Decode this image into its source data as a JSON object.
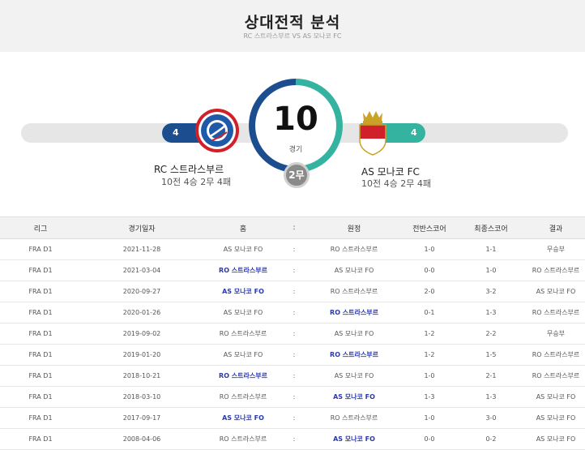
{
  "header": {
    "title": "상대전적 분석",
    "subtitle": "RC 스트라스부르 VS AS 모나코 FC"
  },
  "summary": {
    "total_games": "10",
    "games_unit": "경기",
    "draws_label": "2무",
    "left_wins": "4",
    "right_wins": "4"
  },
  "teams": {
    "home": {
      "name": "RC 스트라스부르",
      "record": "10전 4승 2무 4패",
      "color": "#1b4d8f"
    },
    "away": {
      "name": "AS 모나코 FC",
      "record": "10전 4승 2무 4패",
      "color": "#34b3a0"
    }
  },
  "colors": {
    "draw": "#8a8a8a",
    "winner_text": "#2b3aa8"
  },
  "table": {
    "headers": [
      "리그",
      "경기일자",
      "홈",
      ":",
      "원정",
      "전반스코어",
      "최종스코어",
      "결과"
    ],
    "rows": [
      {
        "league": "FRA D1",
        "date": "2021-11-28",
        "home": "AS 모나코 FO",
        "sep": ":",
        "away": "RO 스트라스부르",
        "half": "1-0",
        "final": "1-1",
        "result": "무승부",
        "winner": "none"
      },
      {
        "league": "FRA D1",
        "date": "2021-03-04",
        "home": "RO 스트라스부르",
        "sep": ":",
        "away": "AS 모나코 FO",
        "half": "0-0",
        "final": "1-0",
        "result": "RO 스트라스부르",
        "winner": "home"
      },
      {
        "league": "FRA D1",
        "date": "2020-09-27",
        "home": "AS 모나코 FO",
        "sep": ":",
        "away": "RO 스트라스부르",
        "half": "2-0",
        "final": "3-2",
        "result": "AS 모나코 FO",
        "winner": "home"
      },
      {
        "league": "FRA D1",
        "date": "2020-01-26",
        "home": "AS 모나코 FO",
        "sep": ":",
        "away": "RO 스트라스부르",
        "half": "0-1",
        "final": "1-3",
        "result": "RO 스트라스부르",
        "winner": "away"
      },
      {
        "league": "FRA D1",
        "date": "2019-09-02",
        "home": "RO 스트라스부르",
        "sep": ":",
        "away": "AS 모나코 FO",
        "half": "1-2",
        "final": "2-2",
        "result": "무승부",
        "winner": "none"
      },
      {
        "league": "FRA D1",
        "date": "2019-01-20",
        "home": "AS 모나코 FO",
        "sep": ":",
        "away": "RO 스트라스부르",
        "half": "1-2",
        "final": "1-5",
        "result": "RO 스트라스부르",
        "winner": "away"
      },
      {
        "league": "FRA D1",
        "date": "2018-10-21",
        "home": "RO 스트라스부르",
        "sep": ":",
        "away": "AS 모나코 FO",
        "half": "1-0",
        "final": "2-1",
        "result": "RO 스트라스부르",
        "winner": "home"
      },
      {
        "league": "FRA D1",
        "date": "2018-03-10",
        "home": "RO 스트라스부르",
        "sep": ":",
        "away": "AS 모나코 FO",
        "half": "1-3",
        "final": "1-3",
        "result": "AS 모나코 FO",
        "winner": "away"
      },
      {
        "league": "FRA D1",
        "date": "2017-09-17",
        "home": "AS 모나코 FO",
        "sep": ":",
        "away": "RO 스트라스부르",
        "half": "1-0",
        "final": "3-0",
        "result": "AS 모나코 FO",
        "winner": "home"
      },
      {
        "league": "FRA D1",
        "date": "2008-04-06",
        "home": "RO 스트라스부르",
        "sep": ":",
        "away": "AS 모나코 FO",
        "half": "0-0",
        "final": "0-2",
        "result": "AS 모나코 FO",
        "winner": "away"
      }
    ]
  }
}
